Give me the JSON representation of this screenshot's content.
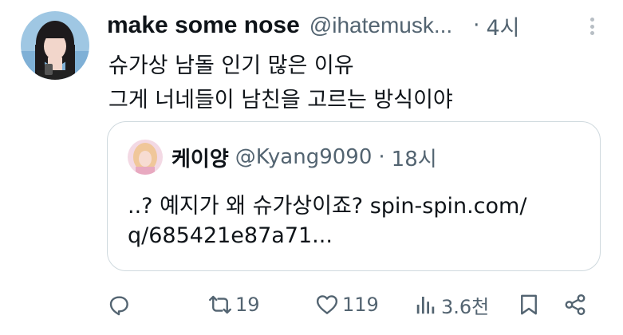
{
  "tweet": {
    "display_name": "make some nose",
    "handle": "@ihatemusk...",
    "separator": "·",
    "time": "4시",
    "text_lines": [
      "슈가상 남돌 인기 많은 이유",
      "그게 너네들이 남친을 고르는 방식이야"
    ]
  },
  "quote": {
    "display_name": "케이양",
    "handle": "@Kyang9090",
    "separator": "·",
    "time": "18시",
    "text_lines": [
      "..? 예지가 왜 슈가상이죠? spin-spin.com/",
      "q/685421e87a71..."
    ]
  },
  "actions": {
    "reply_count": "",
    "retweet_count": "19",
    "like_count": "119",
    "view_count": "3.6천"
  },
  "icons": {
    "more": "more-vertical-icon",
    "reply": "reply-icon",
    "retweet": "retweet-icon",
    "like": "heart-icon",
    "views": "views-chart-icon",
    "bookmark": "bookmark-icon",
    "share": "share-icon"
  },
  "colors": {
    "text_primary": "#0f1419",
    "text_secondary": "#536471",
    "border": "#cfd9de",
    "more_dots": "#b7bec4"
  }
}
